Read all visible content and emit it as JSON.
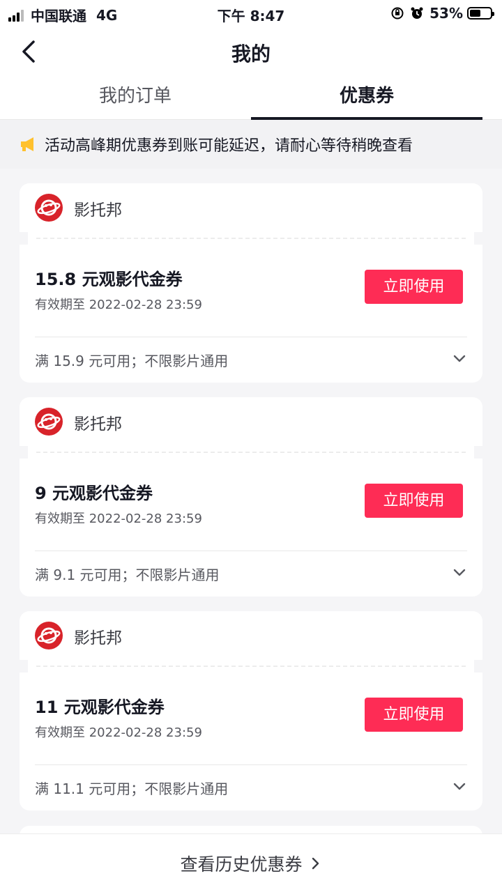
{
  "status_bar": {
    "carrier": "中国联通",
    "network": "4G",
    "time": "下午 8:47",
    "battery": "53%",
    "battery_level": 0.53
  },
  "header": {
    "title": "我的",
    "tabs": [
      {
        "label": "我的订单",
        "active": false
      },
      {
        "label": "优惠券",
        "active": true
      }
    ]
  },
  "notice": {
    "icon": "megaphone-icon",
    "text": "活动高峰期优惠券到账可能延迟，请耐心等待稍晚查看"
  },
  "coupons": [
    {
      "brand": "影托邦",
      "name": "15.8 元观影代金券",
      "expiry": "有效期至 2022-02-28 23:59",
      "button": "立即使用",
      "condition": "满 15.9 元可用；不限影片通用"
    },
    {
      "brand": "影托邦",
      "name": "9 元观影代金券",
      "expiry": "有效期至 2022-02-28 23:59",
      "button": "立即使用",
      "condition": "满 9.1 元可用；不限影片通用"
    },
    {
      "brand": "影托邦",
      "name": "11 元观影代金券",
      "expiry": "有效期至 2022-02-28 23:59",
      "button": "立即使用",
      "condition": "满 11.1 元可用；不限影片通用"
    }
  ],
  "footer": {
    "label": "查看历史优惠券"
  },
  "colors": {
    "accent": "#fe2c55",
    "text": "#161823",
    "background": "#f5f5f7"
  }
}
